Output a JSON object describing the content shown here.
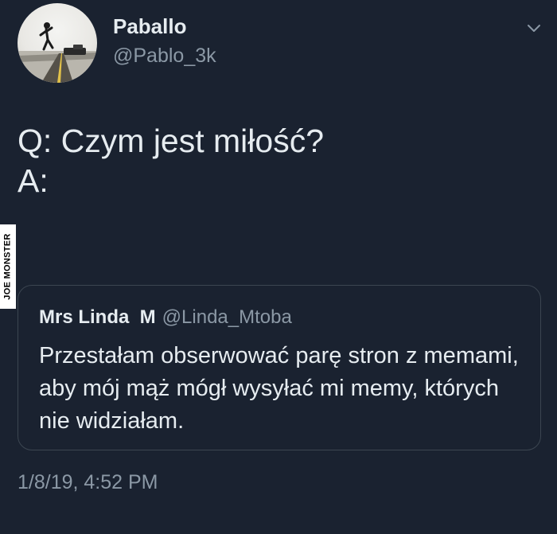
{
  "tweet": {
    "author": {
      "name": "Paballo",
      "handle": "@Pablo_3k"
    },
    "text": "Q: Czym jest miłość?\nA:",
    "timestamp": "1/8/19, 4:52 PM"
  },
  "quoted_tweet": {
    "name": "Mrs Linda  M",
    "handle": "@Linda_Mtoba",
    "text": "Przestałam obserwować parę stron z memami, aby mój mąż mógł wysyłać mi memy, których nie widziałam."
  },
  "watermark": {
    "text": "JOE MONSTER"
  },
  "icons": {
    "menu": "chevron-down-icon",
    "avatar": "avatar-photo"
  },
  "colors": {
    "background": "#1a2230",
    "text": "#e6ecf0",
    "muted": "#8b98a5",
    "border": "#3c4651"
  }
}
